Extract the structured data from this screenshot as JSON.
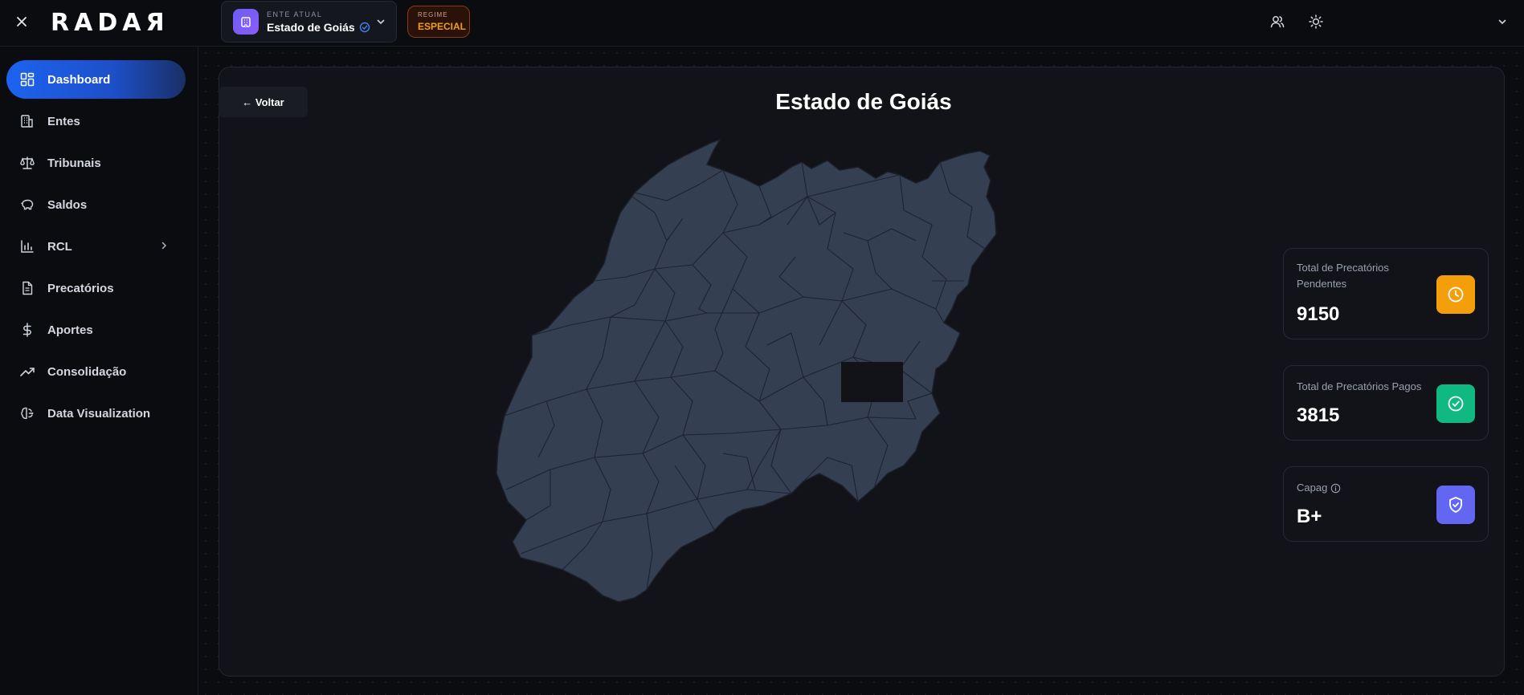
{
  "header": {
    "logo": "RADAЯ",
    "ente": {
      "caption": "ENTE ATUAL",
      "value": "Estado de Goiás"
    },
    "regime": {
      "caption": "REGIME",
      "value": "ESPECIAL"
    }
  },
  "sidebar": {
    "items": [
      {
        "label": "Dashboard",
        "icon": "dashboard-grid-icon",
        "active": true
      },
      {
        "label": "Entes",
        "icon": "building-icon"
      },
      {
        "label": "Tribunais",
        "icon": "scale-icon"
      },
      {
        "label": "Saldos",
        "icon": "piggy-bank-icon"
      },
      {
        "label": "RCL",
        "icon": "bar-chart-icon"
      },
      {
        "label": "Precatórios",
        "icon": "document-icon"
      },
      {
        "label": "Aportes",
        "icon": "dollar-icon"
      },
      {
        "label": "Consolidação",
        "icon": "trending-up-icon"
      },
      {
        "label": "Data Visualization",
        "icon": "brain-icon"
      }
    ]
  },
  "main": {
    "back_label": "← Voltar",
    "title": "Estado de Goiás",
    "stats": [
      {
        "label": "Total de Precatórios Pendentes",
        "value": "9150",
        "icon": "clock-icon",
        "color": "#f59e0b"
      },
      {
        "label": "Total de Precatórios Pagos",
        "value": "3815",
        "icon": "check-circle-icon",
        "color": "#10b981"
      },
      {
        "label": "Capag",
        "value": "B+",
        "icon": "shield-check-icon",
        "color": "#6366f1"
      }
    ]
  },
  "colors": {
    "accent": "#1d63f0",
    "map_fill": "#353f52",
    "background": "#0b0c10",
    "panel": "#121319"
  }
}
